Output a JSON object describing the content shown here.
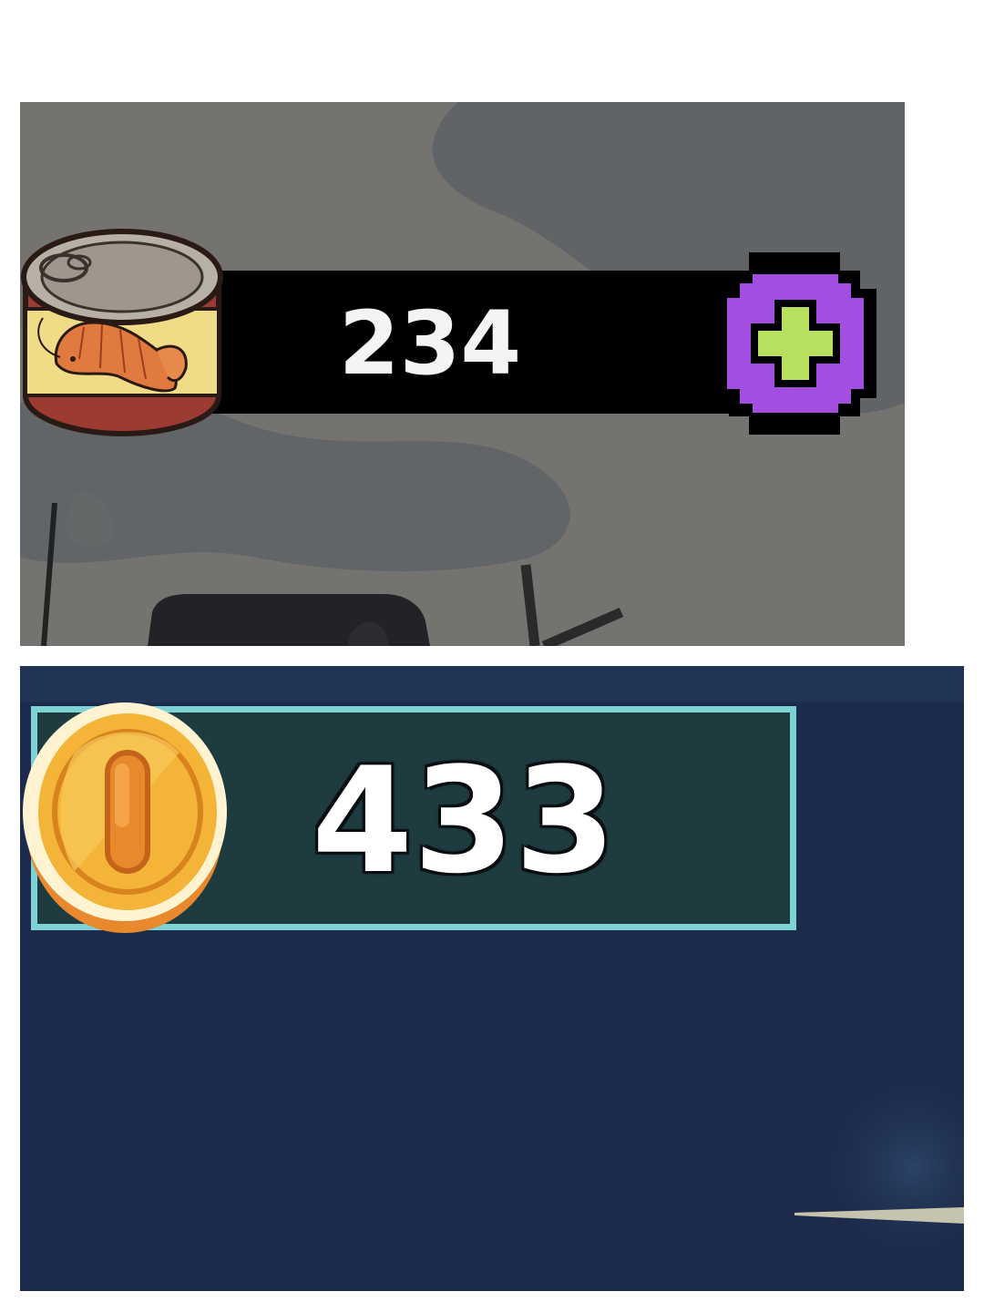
{
  "top_counter": {
    "resource_icon": "canned-shrimp-icon",
    "value": "234",
    "add_button_icon": "plus-icon",
    "colors": {
      "bar": "#000000",
      "button": "#a24ee0",
      "plus": "#b6e05e",
      "background": "#747370"
    }
  },
  "bottom_counter": {
    "resource_icon": "gold-coin-icon",
    "value": "433",
    "colors": {
      "box": "#1e3c40",
      "border": "#7ed2d6",
      "background": "#1c2a4b",
      "coin": "#f4b437"
    }
  }
}
